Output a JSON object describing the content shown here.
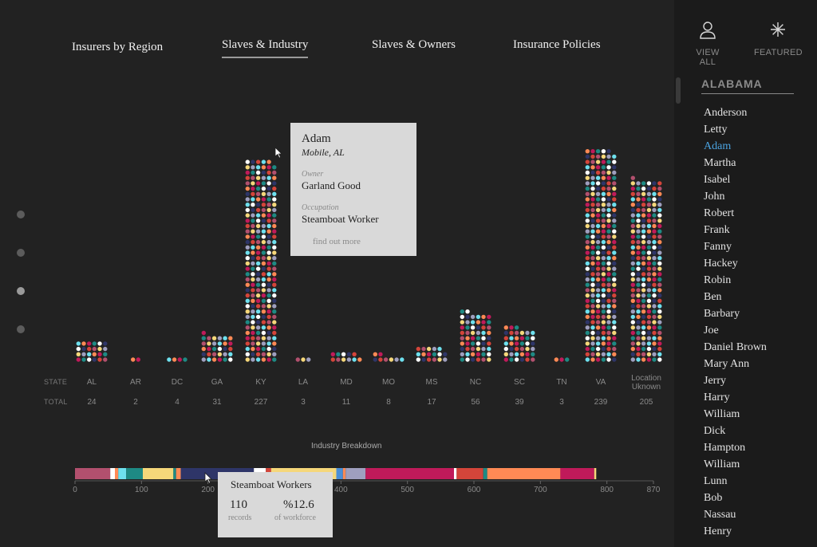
{
  "nav": {
    "tabs": [
      {
        "label": "Insurers by Region"
      },
      {
        "label": "Slaves & Industry"
      },
      {
        "label": "Slaves & Owners"
      },
      {
        "label": "Insurance Policies"
      }
    ],
    "active_tab": "Slaves & Industry"
  },
  "section_dots": {
    "count": 4,
    "active_index": 2
  },
  "colors": {
    "background": "#222222",
    "sidebar": "#1b1b1b",
    "tooltip_bg": "#d9d9d9",
    "accent_link": "#4ba3e0",
    "industry_palette": [
      "#c01a5a",
      "#2e3568",
      "#f5d77a",
      "#ff8a55",
      "#ffffff",
      "#b2506e",
      "#6ee0ee",
      "#1e8a84",
      "#d4453a",
      "#9f9fbf"
    ]
  },
  "chart_data": {
    "type": "dot-stack",
    "row_labels": {
      "state": "STATE",
      "total": "TOTAL"
    },
    "states": [
      "AL",
      "AR",
      "DC",
      "GA",
      "KY",
      "LA",
      "MD",
      "MO",
      "MS",
      "NC",
      "SC",
      "TN",
      "VA",
      "Location Uknown"
    ],
    "totals": [
      24,
      2,
      4,
      31,
      227,
      3,
      11,
      8,
      17,
      56,
      39,
      3,
      239,
      205
    ],
    "breakdown": {
      "title": "Industry Breakdown",
      "ticks": [
        0,
        100,
        200,
        300,
        400,
        500,
        600,
        700,
        800,
        870
      ],
      "max": 870,
      "segments": [
        {
          "color": "#b2506e",
          "value": 53
        },
        {
          "color": "#ffffff",
          "value": 7
        },
        {
          "color": "#ff8a55",
          "value": 5
        },
        {
          "color": "#6ee0ee",
          "value": 12
        },
        {
          "color": "#1e8a84",
          "value": 25
        },
        {
          "color": "#f5d77a",
          "value": 46
        },
        {
          "color": "#1e8a84",
          "value": 4
        },
        {
          "color": "#ff8a55",
          "value": 7
        },
        {
          "color": "#2e3568",
          "value": 110
        },
        {
          "color": "#ffffff",
          "value": 18
        },
        {
          "color": "#d4453a",
          "value": 8
        },
        {
          "color": "#f5d77a",
          "value": 98
        },
        {
          "color": "#4a8fd8",
          "value": 10
        },
        {
          "color": "#ff8a55",
          "value": 4
        },
        {
          "color": "#9f9fbf",
          "value": 30
        },
        {
          "color": "#c01a5a",
          "value": 133
        },
        {
          "color": "#ffffff",
          "value": 4
        },
        {
          "color": "#d4453a",
          "value": 40
        },
        {
          "color": "#1e8a84",
          "value": 6
        },
        {
          "color": "#ff8a55",
          "value": 110
        },
        {
          "color": "#c01a5a",
          "value": 51
        },
        {
          "color": "#f5d77a",
          "value": 3
        }
      ]
    }
  },
  "tooltip": {
    "name": "Adam",
    "location": "Mobile, AL",
    "owner_label": "Owner",
    "owner": "Garland Good",
    "occupation_label": "Occupation",
    "occupation": "Steamboat Worker",
    "link": "find out more"
  },
  "summary": {
    "title": "Steamboat Workers",
    "records": "110",
    "records_label": "records",
    "percent": "%12.6",
    "percent_label": "of workforce"
  },
  "sidebar": {
    "view_all": "VIEW ALL",
    "featured": "FEATURED",
    "state_header": "ALABAMA",
    "selected": "Adam",
    "names": [
      "Anderson",
      "Letty",
      "Adam",
      "Martha",
      "Isabel",
      "John",
      "Robert",
      "Frank",
      "Fanny",
      "Hackey",
      "Robin",
      "Ben",
      "Barbary",
      "Joe",
      "Daniel Brown",
      "Mary Ann",
      "Jerry",
      "Harry",
      "William",
      "Dick",
      "Hampton",
      "William",
      "Lunn",
      "Bob",
      "Nassau",
      "Henry"
    ]
  }
}
